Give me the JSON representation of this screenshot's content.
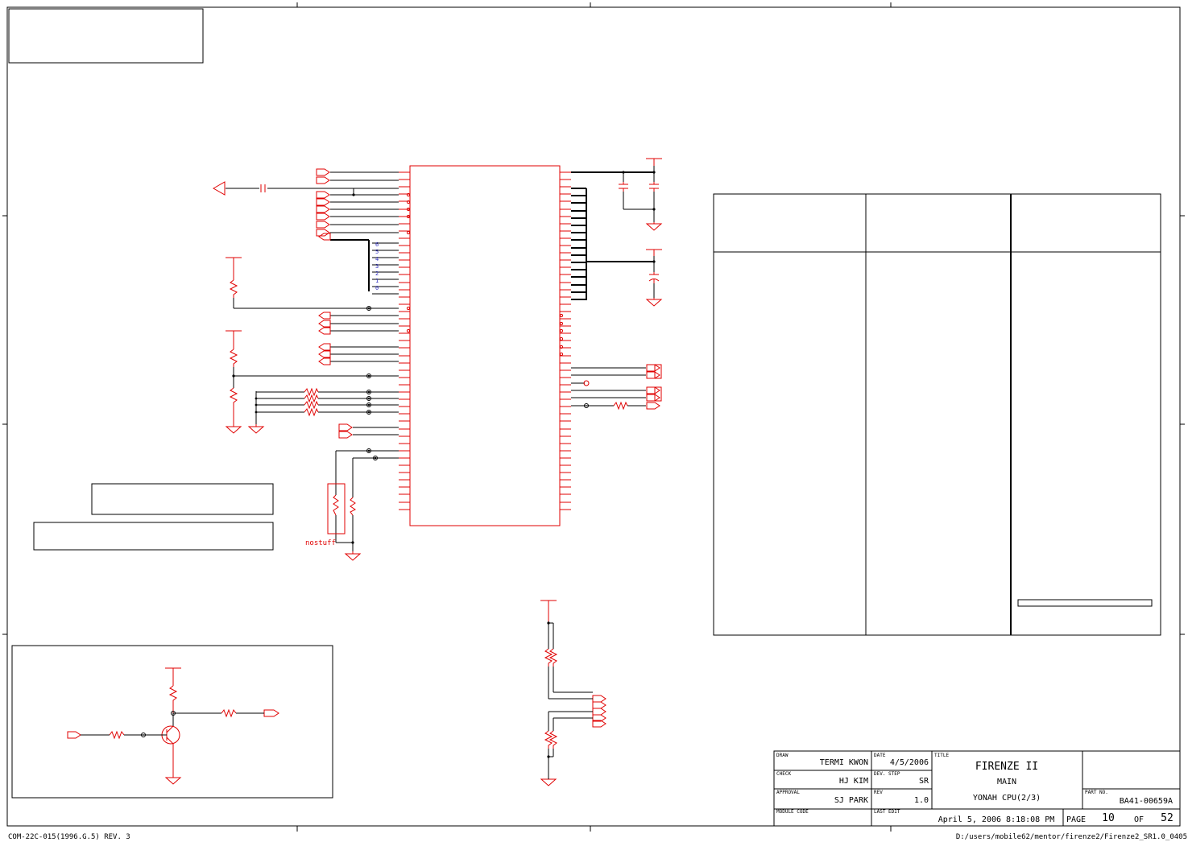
{
  "title_block": {
    "labels": {
      "draw": "DRAW",
      "check": "CHECK",
      "approval": "APPROVAL",
      "module_code": "MODULE CODE",
      "date": "DATE",
      "dev_step": "DEV. STEP",
      "rev": "REV",
      "last_edit": "LAST EDIT",
      "title": "TITLE",
      "part_no": "PART NO.",
      "page": "PAGE",
      "of": "OF"
    },
    "draw": "TERMI KWON",
    "check": "HJ KIM",
    "approval": "SJ PARK",
    "date": "4/5/2006",
    "dev_step": "SR",
    "rev": "1.0",
    "title_line1": "FIRENZE II",
    "title_line2": "MAIN",
    "title_line3": "YONAH CPU(2/3)",
    "part_no": "BA41-00659A",
    "last_edit": "April 5, 2006  8:18:08 PM",
    "page": "10",
    "of": "52"
  },
  "footer": {
    "form_id": "COM-22C-015(1996.G.5) REV. 3",
    "file_path": "D:/users/mobile62/mentor/firenze2/Firenze2_SR1.0_0405"
  },
  "annotations": {
    "nostuff": "nostuff",
    "bus_numbers": [
      "6",
      "5",
      "4",
      "3",
      "2",
      "1",
      "0"
    ]
  },
  "colors": {
    "schematic": "#e00000",
    "wire": "#000000",
    "bus_label": "#3030c0",
    "frame": "#000000"
  }
}
